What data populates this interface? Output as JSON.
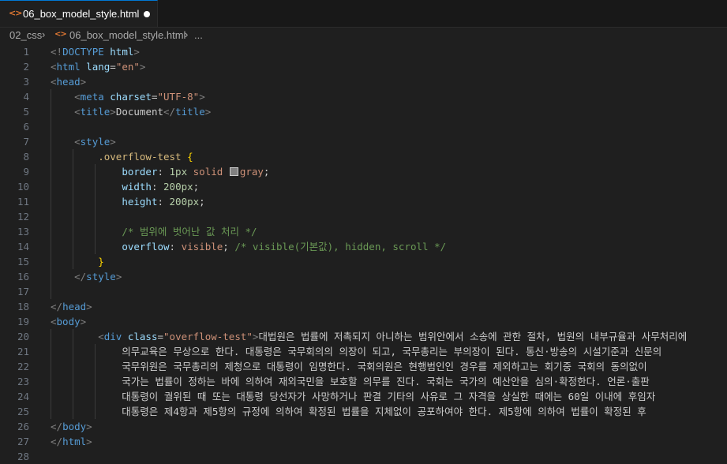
{
  "tab": {
    "icon": "<>",
    "icon_name": "html-file-icon",
    "filename": "06_box_model_style.html",
    "modified_dot": true
  },
  "breadcrumb": {
    "folder": "02_css",
    "file": "06_box_model_style.html",
    "more": "..."
  },
  "colors": {
    "tag_bracket": "#808080",
    "tag_name": "#569cd6",
    "attr_name": "#9cdcfe",
    "attr_value": "#ce9178",
    "selector": "#d7ba7d",
    "comment": "#6a9955",
    "number": "#b5cea8",
    "brace": "#ffd700",
    "accent": "#0078d4"
  },
  "lines": [
    {
      "n": "1",
      "t": [
        [
          "tg",
          "<!"
        ],
        [
          "tn",
          "DOCTYPE"
        ],
        [
          "an",
          " html"
        ],
        [
          "tg",
          ">"
        ]
      ]
    },
    {
      "n": "2",
      "t": [
        [
          "tg",
          "<"
        ],
        [
          "tn",
          "html"
        ],
        [
          "an",
          " lang"
        ],
        [
          "tx",
          "="
        ],
        [
          "av",
          "\"en\""
        ],
        [
          "tg",
          ">"
        ]
      ]
    },
    {
      "n": "3",
      "t": [
        [
          "tg",
          "<"
        ],
        [
          "tn",
          "head"
        ],
        [
          "tg",
          ">"
        ]
      ]
    },
    {
      "n": "4",
      "t": [
        [
          "tx",
          "    "
        ],
        [
          "tg",
          "<"
        ],
        [
          "tn",
          "meta"
        ],
        [
          "an",
          " charset"
        ],
        [
          "tx",
          "="
        ],
        [
          "av",
          "\"UTF-8\""
        ],
        [
          "tg",
          ">"
        ]
      ]
    },
    {
      "n": "5",
      "t": [
        [
          "tx",
          "    "
        ],
        [
          "tg",
          "<"
        ],
        [
          "tn",
          "title"
        ],
        [
          "tg",
          ">"
        ],
        [
          "tx",
          "Document"
        ],
        [
          "tg",
          "</"
        ],
        [
          "tn",
          "title"
        ],
        [
          "tg",
          ">"
        ]
      ]
    },
    {
      "n": "6",
      "t": []
    },
    {
      "n": "7",
      "t": [
        [
          "tx",
          "    "
        ],
        [
          "tg",
          "<"
        ],
        [
          "tn",
          "style"
        ],
        [
          "tg",
          ">"
        ]
      ]
    },
    {
      "n": "8",
      "t": [
        [
          "tx",
          "        "
        ],
        [
          "sel",
          ".overflow-test"
        ],
        [
          "tx",
          " "
        ],
        [
          "br",
          "{"
        ]
      ]
    },
    {
      "n": "9",
      "t": [
        [
          "tx",
          "            "
        ],
        [
          "pr",
          "border"
        ],
        [
          "tx",
          ": "
        ],
        [
          "nm",
          "1px"
        ],
        [
          "tx",
          " "
        ],
        [
          "vl",
          "solid"
        ],
        [
          "tx",
          " "
        ],
        [
          "sw",
          ""
        ],
        [
          "vl",
          "gray"
        ],
        [
          "tx",
          ";"
        ]
      ]
    },
    {
      "n": "10",
      "t": [
        [
          "tx",
          "            "
        ],
        [
          "pr",
          "width"
        ],
        [
          "tx",
          ": "
        ],
        [
          "nm",
          "200px"
        ],
        [
          "tx",
          ";"
        ]
      ]
    },
    {
      "n": "11",
      "t": [
        [
          "tx",
          "            "
        ],
        [
          "pr",
          "height"
        ],
        [
          "tx",
          ": "
        ],
        [
          "nm",
          "200px"
        ],
        [
          "tx",
          ";"
        ]
      ]
    },
    {
      "n": "12",
      "t": []
    },
    {
      "n": "13",
      "t": [
        [
          "tx",
          "            "
        ],
        [
          "cm",
          "/* 범위에 벗어난 값 처리 */"
        ]
      ]
    },
    {
      "n": "14",
      "t": [
        [
          "tx",
          "            "
        ],
        [
          "pr",
          "overflow"
        ],
        [
          "tx",
          ": "
        ],
        [
          "vl",
          "visible"
        ],
        [
          "tx",
          "; "
        ],
        [
          "cm",
          "/* visible(기본값), hidden, scroll */"
        ]
      ]
    },
    {
      "n": "15",
      "t": [
        [
          "tx",
          "        "
        ],
        [
          "br",
          "}"
        ]
      ]
    },
    {
      "n": "16",
      "t": [
        [
          "tx",
          "    "
        ],
        [
          "tg",
          "</"
        ],
        [
          "tn",
          "style"
        ],
        [
          "tg",
          ">"
        ]
      ]
    },
    {
      "n": "17",
      "t": []
    },
    {
      "n": "18",
      "t": [
        [
          "tg",
          "</"
        ],
        [
          "tn",
          "head"
        ],
        [
          "tg",
          ">"
        ]
      ]
    },
    {
      "n": "19",
      "t": [
        [
          "tg",
          "<"
        ],
        [
          "tn",
          "body"
        ],
        [
          "tg",
          ">"
        ]
      ]
    },
    {
      "n": "20",
      "t": [
        [
          "tx",
          "        "
        ],
        [
          "tg",
          "<"
        ],
        [
          "tn",
          "div"
        ],
        [
          "an",
          " class"
        ],
        [
          "tx",
          "="
        ],
        [
          "av",
          "\"overflow-test\""
        ],
        [
          "tg",
          ">"
        ],
        [
          "tx",
          "대법원은 법률에 저촉되지 아니하는 범위안에서 소송에 관한 절차, 법원의 내부규율과 사무처리에"
        ]
      ]
    },
    {
      "n": "21",
      "t": [
        [
          "tx",
          "            의무교육은 무상으로 한다. 대통령은 국무회의의 의장이 되고, 국무총리는 부의장이 된다. 통신·방송의 시설기준과 신문의"
        ]
      ]
    },
    {
      "n": "22",
      "t": [
        [
          "tx",
          "            국무위원은 국무총리의 제청으로 대통령이 임명한다. 국회의원은 현행범인인 경우를 제외하고는 회기중 국회의 동의없이"
        ]
      ]
    },
    {
      "n": "23",
      "t": [
        [
          "tx",
          "            국가는 법률이 정하는 바에 의하여 재외국민을 보호할 의무를 진다. 국회는 국가의 예산안을 심의·확정한다. 언론·출판"
        ]
      ]
    },
    {
      "n": "24",
      "t": [
        [
          "tx",
          "            대통령이 궐위된 때 또는 대통령 당선자가 사망하거나 판결 기타의 사유로 그 자격을 상실한 때에는 60일 이내에 후임자"
        ]
      ]
    },
    {
      "n": "25",
      "t": [
        [
          "tx",
          "            대통령은 제4항과 제5항의 규정에 의하여 확정된 법률을 지체없이 공포하여야 한다. 제5항에 의하여 법률이 확정된 후"
        ]
      ]
    },
    {
      "n": "26",
      "t": [
        [
          "tg",
          "</"
        ],
        [
          "tn",
          "body"
        ],
        [
          "tg",
          ">"
        ]
      ]
    },
    {
      "n": "27",
      "t": [
        [
          "tg",
          "</"
        ],
        [
          "tn",
          "html"
        ],
        [
          "tg",
          ">"
        ]
      ]
    },
    {
      "n": "28",
      "t": []
    }
  ]
}
